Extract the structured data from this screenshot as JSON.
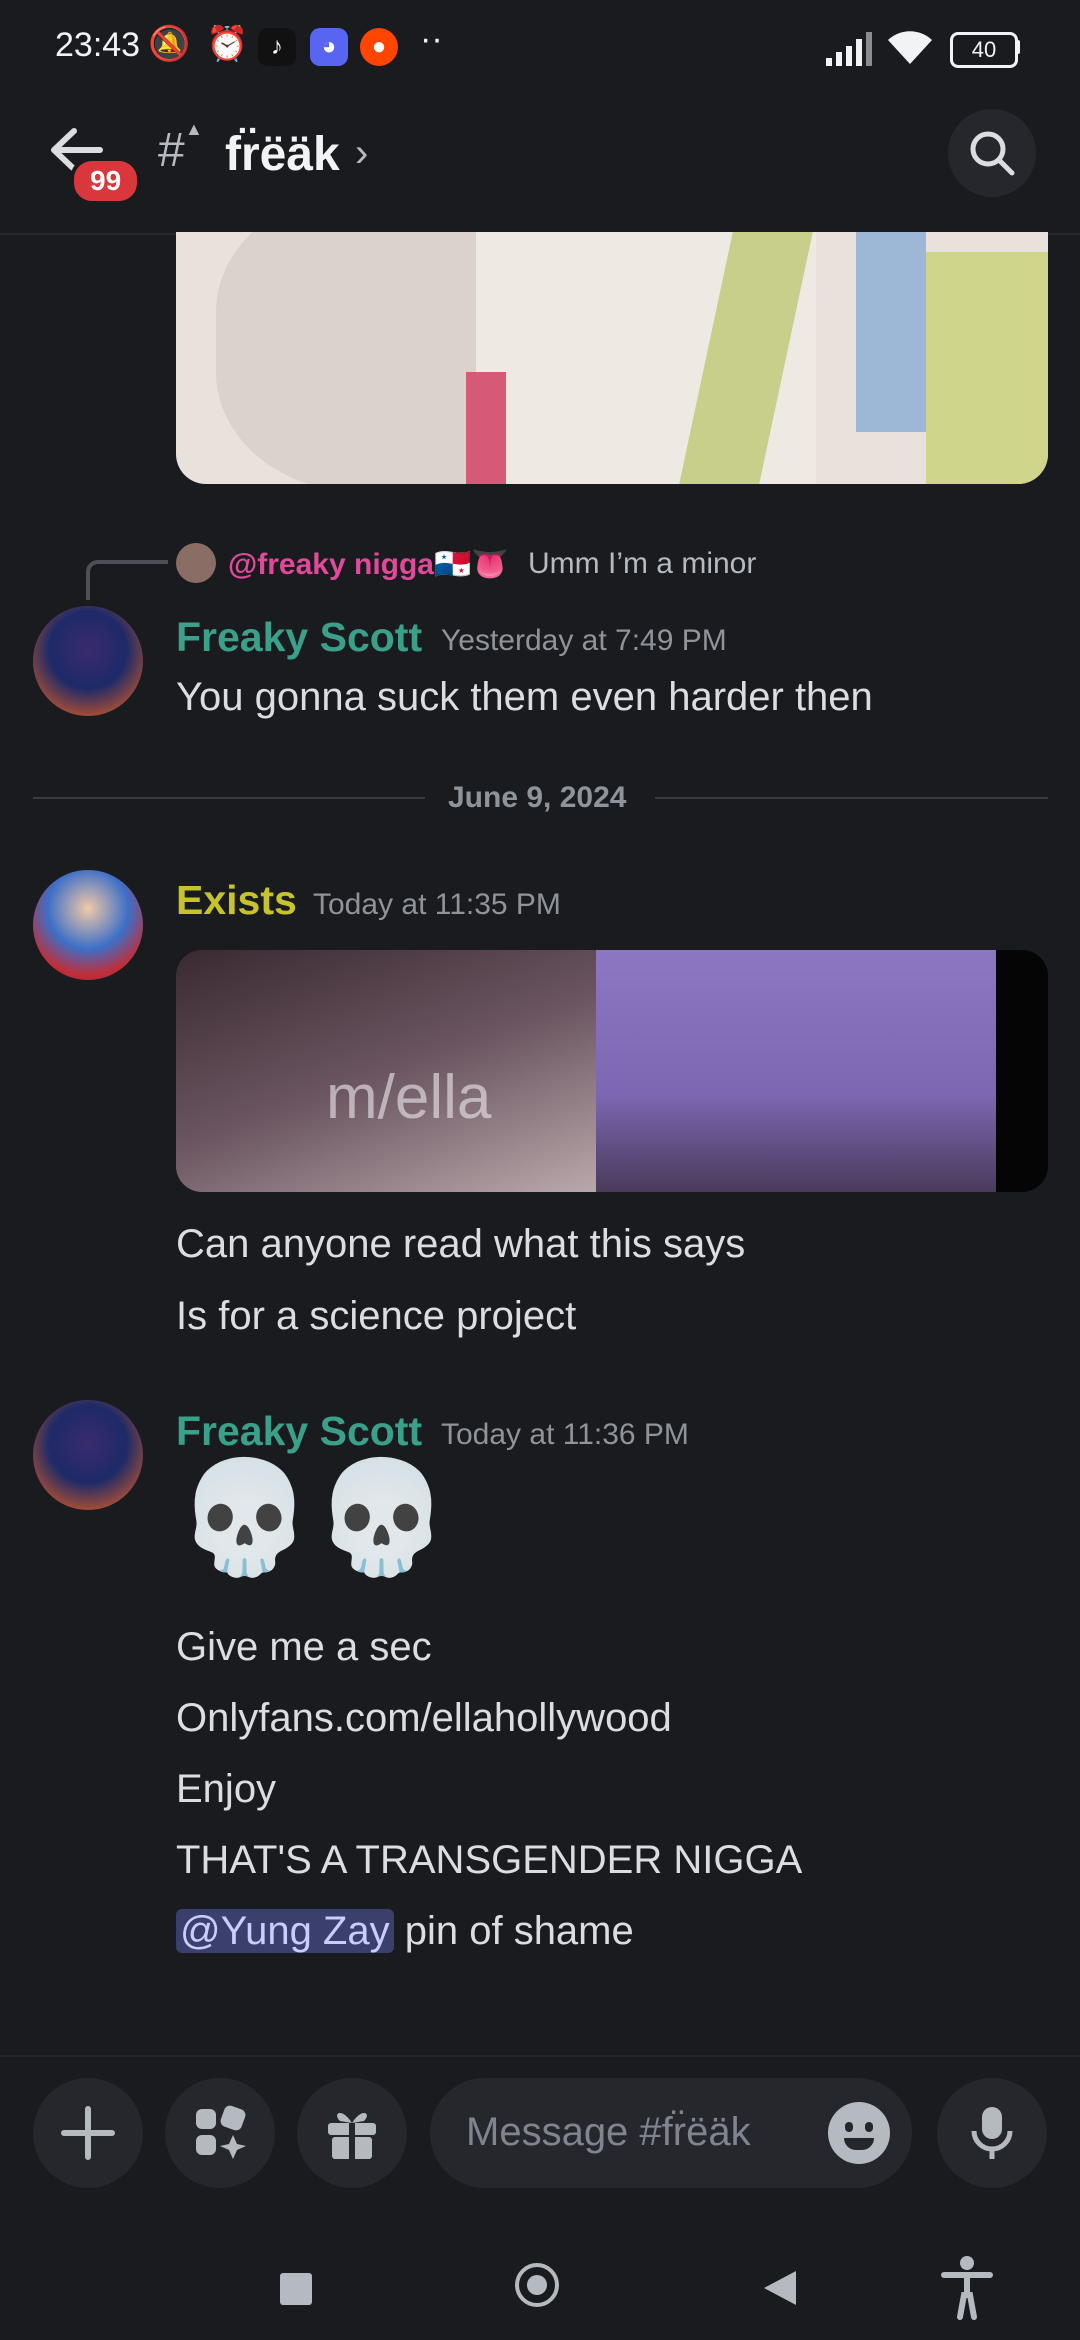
{
  "status_bar": {
    "time": "23:43",
    "battery": "40"
  },
  "header": {
    "unread_badge": "99",
    "channel_name": "fr̈ëäk",
    "chevron": "›"
  },
  "reply": {
    "mention": "@freaky nigga🇵🇦👅",
    "text": "Umm I’m a minor"
  },
  "messages": [
    {
      "author": "Freaky Scott",
      "timestamp": "Yesterday at 7:49 PM",
      "color": "#3aa08a",
      "lines": [
        "You gonna suck them even harder then"
      ]
    },
    {
      "author": "Exists",
      "timestamp": "Today at 11:35 PM",
      "color": "#c7c42b",
      "image_overlay_text": "m/ella",
      "lines": [
        "Can anyone read what this says",
        "Is for a science project"
      ]
    },
    {
      "author": "Freaky Scott",
      "timestamp": "Today at 11:36 PM",
      "color": "#3aa08a",
      "emoji": "💀💀",
      "lines": [
        "Give me a sec",
        "Onlyfans.com/ellahollywood",
        "Enjoy",
        "THAT'S A TRANSGENDER NIGGA"
      ],
      "mention": "@Yung Zay",
      "mention_suffix": " pin of shame"
    }
  ],
  "date_divider": "June 9, 2024",
  "composer": {
    "placeholder": "Message #fr̈ëäk"
  }
}
